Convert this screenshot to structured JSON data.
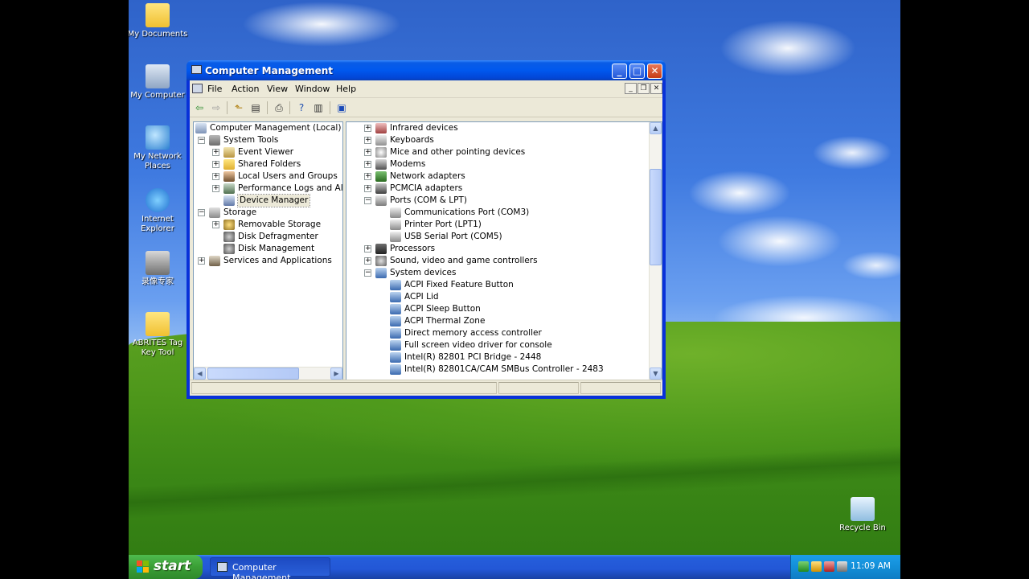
{
  "desktop": {
    "icons": [
      {
        "label": "My Documents"
      },
      {
        "label": "My Computer"
      },
      {
        "label": "My Network Places"
      },
      {
        "label": "Internet Explorer"
      },
      {
        "label": "录像专家"
      },
      {
        "label": "ABRITES Tag Key Tool"
      },
      {
        "label": "Recycle Bin"
      }
    ]
  },
  "window": {
    "title": "Computer Management",
    "menu": [
      "File",
      "Action",
      "View",
      "Window",
      "Help"
    ],
    "tree": [
      {
        "label": "Computer Management (Local)",
        "icon": "computer-icon"
      },
      {
        "label": "System Tools",
        "icon": "tools-icon"
      },
      {
        "label": "Event Viewer",
        "icon": "event-viewer-icon"
      },
      {
        "label": "Shared Folders",
        "icon": "shared-folder-icon"
      },
      {
        "label": "Local Users and Groups",
        "icon": "users-icon"
      },
      {
        "label": "Performance Logs and Alerts",
        "icon": "performance-icon"
      },
      {
        "label": "Device Manager",
        "icon": "device-manager-icon"
      },
      {
        "label": "Storage",
        "icon": "storage-icon"
      },
      {
        "label": "Removable Storage",
        "icon": "removable-storage-icon"
      },
      {
        "label": "Disk Defragmenter",
        "icon": "defrag-icon"
      },
      {
        "label": "Disk Management",
        "icon": "disk-icon"
      },
      {
        "label": "Services and Applications",
        "icon": "services-icon"
      }
    ],
    "devices": [
      {
        "label": "Infrared devices"
      },
      {
        "label": "Keyboards"
      },
      {
        "label": "Mice and other pointing devices"
      },
      {
        "label": "Modems"
      },
      {
        "label": "Network adapters"
      },
      {
        "label": "PCMCIA adapters"
      },
      {
        "label": "Ports (COM & LPT)"
      },
      {
        "label": "Communications Port (COM3)"
      },
      {
        "label": "Printer Port (LPT1)"
      },
      {
        "label": "USB Serial Port (COM5)"
      },
      {
        "label": "Processors"
      },
      {
        "label": "Sound, video and game controllers"
      },
      {
        "label": "System devices"
      },
      {
        "label": "ACPI Fixed Feature Button"
      },
      {
        "label": "ACPI Lid"
      },
      {
        "label": "ACPI Sleep Button"
      },
      {
        "label": "ACPI Thermal Zone"
      },
      {
        "label": "Direct memory access controller"
      },
      {
        "label": "Full screen video driver for console"
      },
      {
        "label": "Intel(R) 82801 PCI Bridge - 2448"
      },
      {
        "label": "Intel(R) 82801CA/CAM SMBus Controller - 2483"
      }
    ]
  },
  "taskbar": {
    "start_label": "start",
    "task_label": "Computer Management",
    "clock": "11:09 AM"
  }
}
